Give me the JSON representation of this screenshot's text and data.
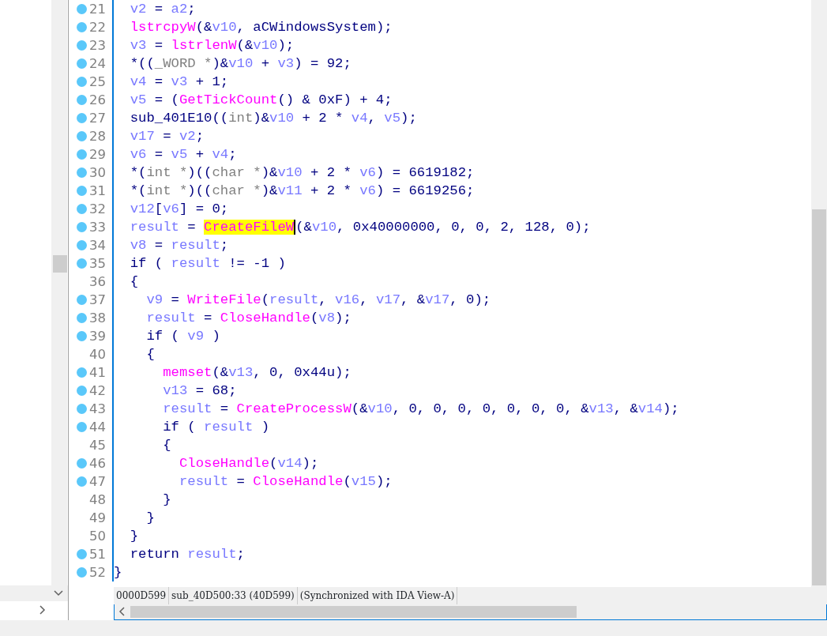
{
  "lines": [
    {
      "num": "21",
      "bp": true,
      "tokens": [
        {
          "t": "  v2",
          "kind": "variable"
        },
        {
          "t": " = ",
          "kind": "plain"
        },
        {
          "t": "a2",
          "kind": "variable"
        },
        {
          "t": ";",
          "kind": "plain"
        }
      ]
    },
    {
      "num": "22",
      "bp": true,
      "tokens": [
        {
          "t": "  lstrcpyW",
          "kind": "function"
        },
        {
          "t": "(&",
          "kind": "plain"
        },
        {
          "t": "v10",
          "kind": "variable"
        },
        {
          "t": ", aCWindowsSystem);",
          "kind": "plain"
        }
      ]
    },
    {
      "num": "23",
      "bp": true,
      "tokens": [
        {
          "t": "  v3",
          "kind": "variable"
        },
        {
          "t": " = ",
          "kind": "plain"
        },
        {
          "t": "lstrlenW",
          "kind": "function"
        },
        {
          "t": "(&",
          "kind": "plain"
        },
        {
          "t": "v10",
          "kind": "variable"
        },
        {
          "t": ");",
          "kind": "plain"
        }
      ]
    },
    {
      "num": "24",
      "bp": true,
      "tokens": [
        {
          "t": "  *((",
          "kind": "plain"
        },
        {
          "t": "_WORD *",
          "kind": "type"
        },
        {
          "t": ")&",
          "kind": "plain"
        },
        {
          "t": "v10",
          "kind": "variable"
        },
        {
          "t": " + ",
          "kind": "plain"
        },
        {
          "t": "v3",
          "kind": "variable"
        },
        {
          "t": ") = 92;",
          "kind": "plain"
        }
      ]
    },
    {
      "num": "25",
      "bp": true,
      "tokens": [
        {
          "t": "  v4",
          "kind": "variable"
        },
        {
          "t": " = ",
          "kind": "plain"
        },
        {
          "t": "v3",
          "kind": "variable"
        },
        {
          "t": " + 1;",
          "kind": "plain"
        }
      ]
    },
    {
      "num": "26",
      "bp": true,
      "tokens": [
        {
          "t": "  v5",
          "kind": "variable"
        },
        {
          "t": " = (",
          "kind": "plain"
        },
        {
          "t": "GetTickCount",
          "kind": "function"
        },
        {
          "t": "() & 0xF) + 4;",
          "kind": "plain"
        }
      ]
    },
    {
      "num": "27",
      "bp": true,
      "tokens": [
        {
          "t": "  sub_401E10((",
          "kind": "plain"
        },
        {
          "t": "int",
          "kind": "type"
        },
        {
          "t": ")&",
          "kind": "plain"
        },
        {
          "t": "v10",
          "kind": "variable"
        },
        {
          "t": " + 2 * ",
          "kind": "plain"
        },
        {
          "t": "v4",
          "kind": "variable"
        },
        {
          "t": ", ",
          "kind": "plain"
        },
        {
          "t": "v5",
          "kind": "variable"
        },
        {
          "t": ");",
          "kind": "plain"
        }
      ]
    },
    {
      "num": "28",
      "bp": true,
      "tokens": [
        {
          "t": "  v17",
          "kind": "variable"
        },
        {
          "t": " = ",
          "kind": "plain"
        },
        {
          "t": "v2",
          "kind": "variable"
        },
        {
          "t": ";",
          "kind": "plain"
        }
      ]
    },
    {
      "num": "29",
      "bp": true,
      "tokens": [
        {
          "t": "  v6",
          "kind": "variable"
        },
        {
          "t": " = ",
          "kind": "plain"
        },
        {
          "t": "v5",
          "kind": "variable"
        },
        {
          "t": " + ",
          "kind": "plain"
        },
        {
          "t": "v4",
          "kind": "variable"
        },
        {
          "t": ";",
          "kind": "plain"
        }
      ]
    },
    {
      "num": "30",
      "bp": true,
      "tokens": [
        {
          "t": "  *(",
          "kind": "plain"
        },
        {
          "t": "int *",
          "kind": "type"
        },
        {
          "t": ")((",
          "kind": "plain"
        },
        {
          "t": "char *",
          "kind": "type"
        },
        {
          "t": ")&",
          "kind": "plain"
        },
        {
          "t": "v10",
          "kind": "variable"
        },
        {
          "t": " + 2 * ",
          "kind": "plain"
        },
        {
          "t": "v6",
          "kind": "variable"
        },
        {
          "t": ") = 6619182;",
          "kind": "plain"
        }
      ]
    },
    {
      "num": "31",
      "bp": true,
      "tokens": [
        {
          "t": "  *(",
          "kind": "plain"
        },
        {
          "t": "int *",
          "kind": "type"
        },
        {
          "t": ")((",
          "kind": "plain"
        },
        {
          "t": "char *",
          "kind": "type"
        },
        {
          "t": ")&",
          "kind": "plain"
        },
        {
          "t": "v11",
          "kind": "variable"
        },
        {
          "t": " + 2 * ",
          "kind": "plain"
        },
        {
          "t": "v6",
          "kind": "variable"
        },
        {
          "t": ") = 6619256;",
          "kind": "plain"
        }
      ]
    },
    {
      "num": "32",
      "bp": true,
      "tokens": [
        {
          "t": "  v12",
          "kind": "variable"
        },
        {
          "t": "[",
          "kind": "plain"
        },
        {
          "t": "v6",
          "kind": "variable"
        },
        {
          "t": "] = 0;",
          "kind": "plain"
        }
      ]
    },
    {
      "num": "33",
      "bp": true,
      "tokens": [
        {
          "t": "  result",
          "kind": "variable"
        },
        {
          "t": " = ",
          "kind": "plain"
        },
        {
          "t": "CreateFileW",
          "kind": "highlight"
        },
        {
          "t": "(&",
          "kind": "plain"
        },
        {
          "t": "v10",
          "kind": "variable"
        },
        {
          "t": ", 0x40000000, 0, 0, 2, 128, 0);",
          "kind": "plain"
        }
      ]
    },
    {
      "num": "34",
      "bp": true,
      "tokens": [
        {
          "t": "  v8",
          "kind": "variable"
        },
        {
          "t": " = ",
          "kind": "plain"
        },
        {
          "t": "result",
          "kind": "variable"
        },
        {
          "t": ";",
          "kind": "plain"
        }
      ]
    },
    {
      "num": "35",
      "bp": true,
      "tokens": [
        {
          "t": "  if ( ",
          "kind": "plain"
        },
        {
          "t": "result",
          "kind": "variable"
        },
        {
          "t": " != -1 )",
          "kind": "plain"
        }
      ]
    },
    {
      "num": "36",
      "bp": false,
      "tokens": [
        {
          "t": "  {",
          "kind": "plain"
        }
      ]
    },
    {
      "num": "37",
      "bp": true,
      "tokens": [
        {
          "t": "    v9",
          "kind": "variable"
        },
        {
          "t": " = ",
          "kind": "plain"
        },
        {
          "t": "WriteFile",
          "kind": "function"
        },
        {
          "t": "(",
          "kind": "plain"
        },
        {
          "t": "result",
          "kind": "variable"
        },
        {
          "t": ", ",
          "kind": "plain"
        },
        {
          "t": "v16",
          "kind": "variable"
        },
        {
          "t": ", ",
          "kind": "plain"
        },
        {
          "t": "v17",
          "kind": "variable"
        },
        {
          "t": ", &",
          "kind": "plain"
        },
        {
          "t": "v17",
          "kind": "variable"
        },
        {
          "t": ", 0);",
          "kind": "plain"
        }
      ]
    },
    {
      "num": "38",
      "bp": true,
      "tokens": [
        {
          "t": "    result",
          "kind": "variable"
        },
        {
          "t": " = ",
          "kind": "plain"
        },
        {
          "t": "CloseHandle",
          "kind": "function"
        },
        {
          "t": "(",
          "kind": "plain"
        },
        {
          "t": "v8",
          "kind": "variable"
        },
        {
          "t": ");",
          "kind": "plain"
        }
      ]
    },
    {
      "num": "39",
      "bp": true,
      "tokens": [
        {
          "t": "    if ( ",
          "kind": "plain"
        },
        {
          "t": "v9",
          "kind": "variable"
        },
        {
          "t": " )",
          "kind": "plain"
        }
      ]
    },
    {
      "num": "40",
      "bp": false,
      "tokens": [
        {
          "t": "    {",
          "kind": "plain"
        }
      ]
    },
    {
      "num": "41",
      "bp": true,
      "tokens": [
        {
          "t": "      memset",
          "kind": "function"
        },
        {
          "t": "(&",
          "kind": "plain"
        },
        {
          "t": "v13",
          "kind": "variable"
        },
        {
          "t": ", 0, 0x44u);",
          "kind": "plain"
        }
      ]
    },
    {
      "num": "42",
      "bp": true,
      "tokens": [
        {
          "t": "      v13",
          "kind": "variable"
        },
        {
          "t": " = 68;",
          "kind": "plain"
        }
      ]
    },
    {
      "num": "43",
      "bp": true,
      "tokens": [
        {
          "t": "      result",
          "kind": "variable"
        },
        {
          "t": " = ",
          "kind": "plain"
        },
        {
          "t": "CreateProcessW",
          "kind": "function"
        },
        {
          "t": "(&",
          "kind": "plain"
        },
        {
          "t": "v10",
          "kind": "variable"
        },
        {
          "t": ", 0, 0, 0, 0, 0, 0, 0, &",
          "kind": "plain"
        },
        {
          "t": "v13",
          "kind": "variable"
        },
        {
          "t": ", &",
          "kind": "plain"
        },
        {
          "t": "v14",
          "kind": "variable"
        },
        {
          "t": ");",
          "kind": "plain"
        }
      ]
    },
    {
      "num": "44",
      "bp": true,
      "tokens": [
        {
          "t": "      if ( ",
          "kind": "plain"
        },
        {
          "t": "result",
          "kind": "variable"
        },
        {
          "t": " )",
          "kind": "plain"
        }
      ]
    },
    {
      "num": "45",
      "bp": false,
      "tokens": [
        {
          "t": "      {",
          "kind": "plain"
        }
      ]
    },
    {
      "num": "46",
      "bp": true,
      "tokens": [
        {
          "t": "        CloseHandle",
          "kind": "function"
        },
        {
          "t": "(",
          "kind": "plain"
        },
        {
          "t": "v14",
          "kind": "variable"
        },
        {
          "t": ");",
          "kind": "plain"
        }
      ]
    },
    {
      "num": "47",
      "bp": true,
      "tokens": [
        {
          "t": "        result",
          "kind": "variable"
        },
        {
          "t": " = ",
          "kind": "plain"
        },
        {
          "t": "CloseHandle",
          "kind": "function"
        },
        {
          "t": "(",
          "kind": "plain"
        },
        {
          "t": "v15",
          "kind": "variable"
        },
        {
          "t": ");",
          "kind": "plain"
        }
      ]
    },
    {
      "num": "48",
      "bp": false,
      "tokens": [
        {
          "t": "      }",
          "kind": "plain"
        }
      ]
    },
    {
      "num": "49",
      "bp": false,
      "tokens": [
        {
          "t": "    }",
          "kind": "plain"
        }
      ]
    },
    {
      "num": "50",
      "bp": false,
      "tokens": [
        {
          "t": "  }",
          "kind": "plain"
        }
      ]
    },
    {
      "num": "51",
      "bp": true,
      "tokens": [
        {
          "t": "  return ",
          "kind": "plain"
        },
        {
          "t": "result",
          "kind": "variable"
        },
        {
          "t": ";",
          "kind": "plain"
        }
      ]
    },
    {
      "num": "52",
      "bp": true,
      "tokens": [
        {
          "t": "}",
          "kind": "plain"
        }
      ]
    }
  ],
  "status_bar": [
    "0000D599",
    "sub_40D500:33 (40D599)",
    "(Synchronized with IDA View-A)"
  ]
}
